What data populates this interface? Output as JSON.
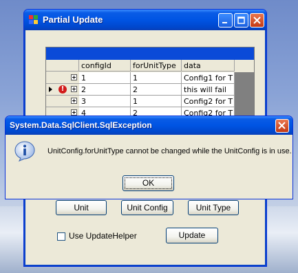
{
  "window": {
    "title": "Partial Update"
  },
  "grid": {
    "columns": [
      "configId",
      "forUnitType",
      "data"
    ],
    "rows": [
      {
        "configId": "1",
        "forUnitType": "1",
        "data": "Config1 for T",
        "error": false
      },
      {
        "configId": "2",
        "forUnitType": "2",
        "data": "this will fail",
        "error": true
      },
      {
        "configId": "3",
        "forUnitType": "1",
        "data": "Config2 for T",
        "error": false
      },
      {
        "configId": "4",
        "forUnitType": "2",
        "data": "Config2 for T",
        "error": false
      }
    ]
  },
  "buttons": {
    "unit": "Unit",
    "unit_config": "Unit Config",
    "unit_type": "Unit Type",
    "update": "Update"
  },
  "checkbox": {
    "label": "Use UpdateHelper",
    "checked": false
  },
  "dialog": {
    "title": "System.Data.SqlClient.SqlException",
    "message": "UnitConfig.forUnitType cannot be changed while the UnitConfig is in use.",
    "ok": "OK"
  },
  "icons": {
    "info": "information-icon",
    "error_row": "error-icon"
  },
  "colors": {
    "titlebar": "#0054e3",
    "window_bg": "#ece9d8",
    "close": "#c43a14",
    "grid_caption": "#0a4ad8"
  }
}
